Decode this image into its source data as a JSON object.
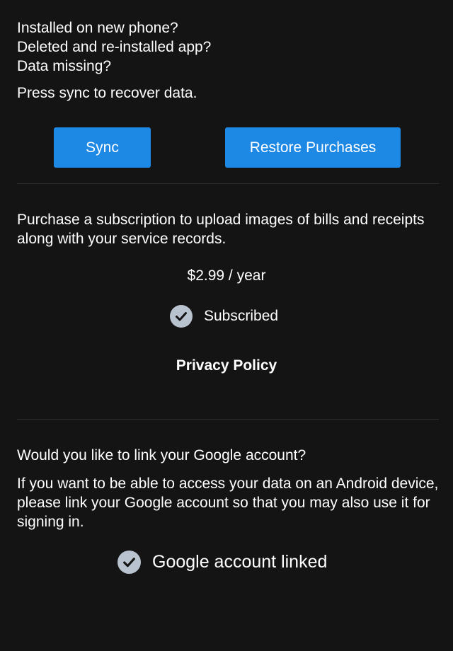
{
  "recovery": {
    "lines": [
      "Installed on new phone?",
      "Deleted and re-installed app?",
      "Data missing?"
    ],
    "instruction": "Press sync to recover data.",
    "sync_label": "Sync",
    "restore_label": "Restore Purchases"
  },
  "subscription": {
    "description": "Purchase a subscription to upload images of bills and receipts along with your service records.",
    "price": "$2.99 / year",
    "status": "Subscribed",
    "privacy_label": "Privacy Policy"
  },
  "google": {
    "question": "Would you like to link your Google account?",
    "description": "If you want to be able to access your data on an Android device, please link your Google account so that you may also use it for signing in.",
    "status": "Google account linked"
  },
  "colors": {
    "background": "#141414",
    "button": "#1e88e5",
    "check": "#b9c3cf",
    "divider": "#2c2c2c"
  },
  "icons": {
    "check": "check-circle-icon"
  }
}
